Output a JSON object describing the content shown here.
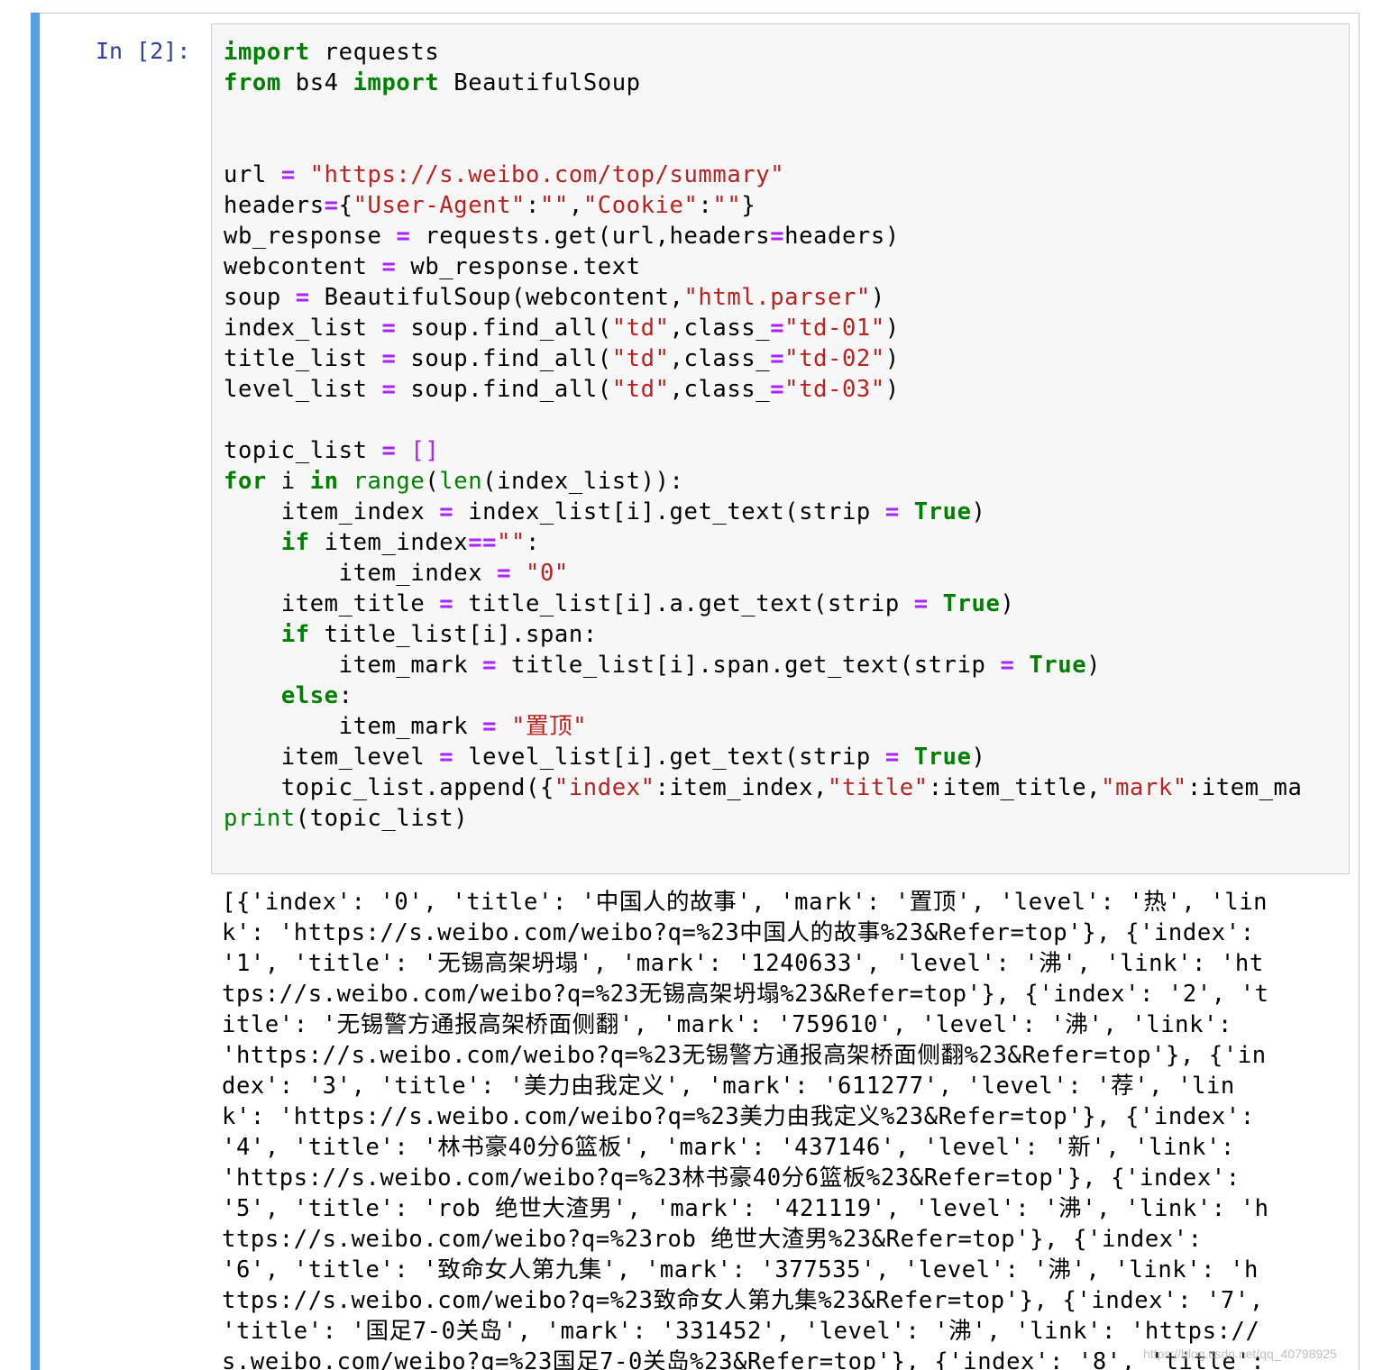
{
  "cell": {
    "prompt": "In [2]:",
    "code_lines": [
      [
        {
          "t": "import",
          "c": "kw"
        },
        {
          "t": " requests"
        }
      ],
      [
        {
          "t": "from",
          "c": "kw"
        },
        {
          "t": " bs4 "
        },
        {
          "t": "import",
          "c": "kw"
        },
        {
          "t": " BeautifulSoup"
        }
      ],
      [],
      [],
      [
        {
          "t": "url "
        },
        {
          "t": "=",
          "c": "op"
        },
        {
          "t": " "
        },
        {
          "t": "\"https://s.weibo.com/top/summary\"",
          "c": "str"
        }
      ],
      [
        {
          "t": "headers"
        },
        {
          "t": "=",
          "c": "op"
        },
        {
          "t": "{"
        },
        {
          "t": "\"User-Agent\"",
          "c": "str"
        },
        {
          "t": ":"
        },
        {
          "t": "\"\"",
          "c": "str"
        },
        {
          "t": ","
        },
        {
          "t": "\"Cookie\"",
          "c": "str"
        },
        {
          "t": ":"
        },
        {
          "t": "\"\"",
          "c": "str"
        },
        {
          "t": "}"
        }
      ],
      [
        {
          "t": "wb_response "
        },
        {
          "t": "=",
          "c": "op"
        },
        {
          "t": " requests.get(url,headers"
        },
        {
          "t": "=",
          "c": "op"
        },
        {
          "t": "headers)"
        }
      ],
      [
        {
          "t": "webcontent "
        },
        {
          "t": "=",
          "c": "op"
        },
        {
          "t": " wb_response.text"
        }
      ],
      [
        {
          "t": "soup "
        },
        {
          "t": "=",
          "c": "op"
        },
        {
          "t": " BeautifulSoup(webcontent,"
        },
        {
          "t": "\"html.parser\"",
          "c": "str"
        },
        {
          "t": ")"
        }
      ],
      [
        {
          "t": "index_list "
        },
        {
          "t": "=",
          "c": "op"
        },
        {
          "t": " soup.find_all("
        },
        {
          "t": "\"td\"",
          "c": "str"
        },
        {
          "t": ",class_"
        },
        {
          "t": "=",
          "c": "op"
        },
        {
          "t": "\"td-01\"",
          "c": "str"
        },
        {
          "t": ")"
        }
      ],
      [
        {
          "t": "title_list "
        },
        {
          "t": "=",
          "c": "op"
        },
        {
          "t": " soup.find_all("
        },
        {
          "t": "\"td\"",
          "c": "str"
        },
        {
          "t": ",class_"
        },
        {
          "t": "=",
          "c": "op"
        },
        {
          "t": "\"td-02\"",
          "c": "str"
        },
        {
          "t": ")"
        }
      ],
      [
        {
          "t": "level_list "
        },
        {
          "t": "=",
          "c": "op"
        },
        {
          "t": " soup.find_all("
        },
        {
          "t": "\"td\"",
          "c": "str"
        },
        {
          "t": ",class_"
        },
        {
          "t": "=",
          "c": "op"
        },
        {
          "t": "\"td-03\"",
          "c": "str"
        },
        {
          "t": ")"
        }
      ],
      [],
      [
        {
          "t": "topic_list "
        },
        {
          "t": "=",
          "c": "op"
        },
        {
          "t": " "
        },
        {
          "t": "[]",
          "c": "br"
        }
      ],
      [
        {
          "t": "for",
          "c": "kw"
        },
        {
          "t": " i "
        },
        {
          "t": "in",
          "c": "kw"
        },
        {
          "t": " "
        },
        {
          "t": "range",
          "c": "bi"
        },
        {
          "t": "("
        },
        {
          "t": "len",
          "c": "bi"
        },
        {
          "t": "(index_list)):"
        }
      ],
      [
        {
          "t": "    item_index "
        },
        {
          "t": "=",
          "c": "op"
        },
        {
          "t": " index_list[i].get_text(strip "
        },
        {
          "t": "=",
          "c": "op"
        },
        {
          "t": " "
        },
        {
          "t": "True",
          "c": "kw"
        },
        {
          "t": ")"
        }
      ],
      [
        {
          "t": "    "
        },
        {
          "t": "if",
          "c": "kw"
        },
        {
          "t": " item_index"
        },
        {
          "t": "==",
          "c": "op"
        },
        {
          "t": "\"\"",
          "c": "str"
        },
        {
          "t": ":"
        }
      ],
      [
        {
          "t": "        item_index "
        },
        {
          "t": "=",
          "c": "op"
        },
        {
          "t": " "
        },
        {
          "t": "\"0\"",
          "c": "str"
        }
      ],
      [
        {
          "t": "    item_title "
        },
        {
          "t": "=",
          "c": "op"
        },
        {
          "t": " title_list[i].a.get_text(strip "
        },
        {
          "t": "=",
          "c": "op"
        },
        {
          "t": " "
        },
        {
          "t": "True",
          "c": "kw"
        },
        {
          "t": ")"
        }
      ],
      [
        {
          "t": "    "
        },
        {
          "t": "if",
          "c": "kw"
        },
        {
          "t": " title_list[i].span:"
        }
      ],
      [
        {
          "t": "        item_mark "
        },
        {
          "t": "=",
          "c": "op"
        },
        {
          "t": " title_list[i].span.get_text(strip "
        },
        {
          "t": "=",
          "c": "op"
        },
        {
          "t": " "
        },
        {
          "t": "True",
          "c": "kw"
        },
        {
          "t": ")"
        }
      ],
      [
        {
          "t": "    "
        },
        {
          "t": "else",
          "c": "kw"
        },
        {
          "t": ":"
        }
      ],
      [
        {
          "t": "        item_mark "
        },
        {
          "t": "=",
          "c": "op"
        },
        {
          "t": " "
        },
        {
          "t": "\"置顶\"",
          "c": "str"
        }
      ],
      [
        {
          "t": "    item_level "
        },
        {
          "t": "=",
          "c": "op"
        },
        {
          "t": " level_list[i].get_text(strip "
        },
        {
          "t": "=",
          "c": "op"
        },
        {
          "t": " "
        },
        {
          "t": "True",
          "c": "kw"
        },
        {
          "t": ")"
        }
      ],
      [
        {
          "t": "    topic_list.append({"
        },
        {
          "t": "\"index\"",
          "c": "str"
        },
        {
          "t": ":item_index,"
        },
        {
          "t": "\"title\"",
          "c": "str"
        },
        {
          "t": ":item_title,"
        },
        {
          "t": "\"mark\"",
          "c": "str"
        },
        {
          "t": ":item_ma"
        }
      ],
      [
        {
          "t": "print",
          "c": "bi"
        },
        {
          "t": "(topic_list)"
        }
      ]
    ],
    "output_lines": [
      "[{'index': '0', 'title': '中国人的故事', 'mark': '置顶', 'level': '热', 'lin",
      "k': 'https://s.weibo.com/weibo?q=%23中国人的故事%23&Refer=top'}, {'index':",
      "'1', 'title': '无锡高架坍塌', 'mark': '1240633', 'level': '沸', 'link': 'ht",
      "tps://s.weibo.com/weibo?q=%23无锡高架坍塌%23&Refer=top'}, {'index': '2', 't",
      "itle': '无锡警方通报高架桥面侧翻', 'mark': '759610', 'level': '沸', 'link':",
      "'https://s.weibo.com/weibo?q=%23无锡警方通报高架桥面侧翻%23&Refer=top'}, {'in",
      "dex': '3', 'title': '美力由我定义', 'mark': '611277', 'level': '荐', 'lin",
      "k': 'https://s.weibo.com/weibo?q=%23美力由我定义%23&Refer=top'}, {'index':",
      "'4', 'title': '林书豪40分6篮板', 'mark': '437146', 'level': '新', 'link':",
      "'https://s.weibo.com/weibo?q=%23林书豪40分6篮板%23&Refer=top'}, {'index':",
      "'5', 'title': 'rob 绝世大渣男', 'mark': '421119', 'level': '沸', 'link': 'h",
      "ttps://s.weibo.com/weibo?q=%23rob 绝世大渣男%23&Refer=top'}, {'index':",
      "'6', 'title': '致命女人第九集', 'mark': '377535', 'level': '沸', 'link': 'h",
      "ttps://s.weibo.com/weibo?q=%23致命女人第九集%23&Refer=top'}, {'index': '7',",
      "'title': '国足7-0关岛', 'mark': '331452', 'level': '沸', 'link': 'https://",
      "s.weibo.com/weibo?q=%23国足7-0关岛%23&Refer=top'}, {'index': '8', 'title':"
    ]
  },
  "watermark": "https://blog.csdn.net/qq_40798925",
  "colors": {
    "selection_bar": "#52a0e6",
    "prompt": "#303f9f",
    "keyword": "#008000",
    "string": "#ba2121",
    "operator": "#aa22ff",
    "input_bg": "#f7f7f7"
  }
}
